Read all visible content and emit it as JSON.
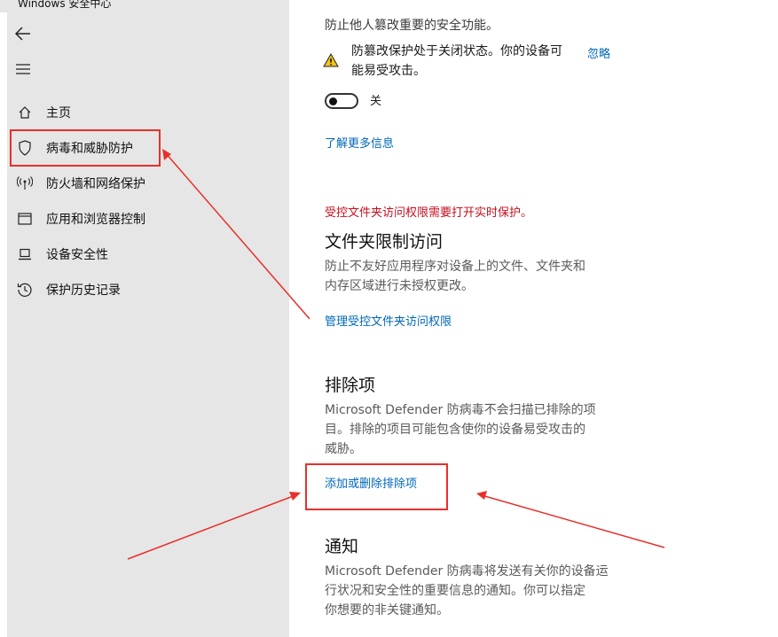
{
  "window": {
    "title": "Windows 安全中心"
  },
  "sidebar": {
    "back_icon": "back-arrow-icon",
    "menu_icon": "hamburger-menu-icon",
    "items": [
      {
        "label": "主页",
        "icon": "home-icon"
      },
      {
        "label": "病毒和威胁防护",
        "icon": "shield-icon"
      },
      {
        "label": "防火墙和网络保护",
        "icon": "wireless-antenna-icon"
      },
      {
        "label": "应用和浏览器控制",
        "icon": "app-window-icon"
      },
      {
        "label": "设备安全性",
        "icon": "laptop-icon"
      },
      {
        "label": "保护历史记录",
        "icon": "history-icon"
      }
    ]
  },
  "main": {
    "tamper": {
      "desc": "防止他人篡改重要的安全功能。",
      "warning_line1": "防篡改保护处于关闭状态。你的设备可",
      "warning_line2": "能易受攻击。",
      "ignore": "忽略",
      "toggle_label": "关",
      "toggle_on": false,
      "learn_more": "了解更多信息"
    },
    "cfa": {
      "alert": "受控文件夹访问权限需要打开实时保护。",
      "title": "文件夹限制访问",
      "desc_line1": "防止不友好应用程序对设备上的文件、文件夹和",
      "desc_line2": "内存区域进行未授权更改。",
      "link": "管理受控文件夹访问权限"
    },
    "exclusions": {
      "title": "排除项",
      "desc_line1": "Microsoft Defender 防病毒不会扫描已排除的项",
      "desc_line2": "目。排除的项目可能包含使你的设备易受攻击的",
      "desc_line3": "威胁。",
      "link": "添加或删除排除项"
    },
    "notifications": {
      "title": "通知",
      "desc_line1": "Microsoft Defender 防病毒将发送有关你的设备运",
      "desc_line2": "行状况和安全性的重要信息的通知。你可以指定",
      "desc_line3": "你想要的非关键通知。"
    }
  },
  "colors": {
    "accent": "#0067b8",
    "alert": "#c50f1f",
    "annotation": "#e8302a",
    "sidebar_bg": "#e6e6e6"
  }
}
